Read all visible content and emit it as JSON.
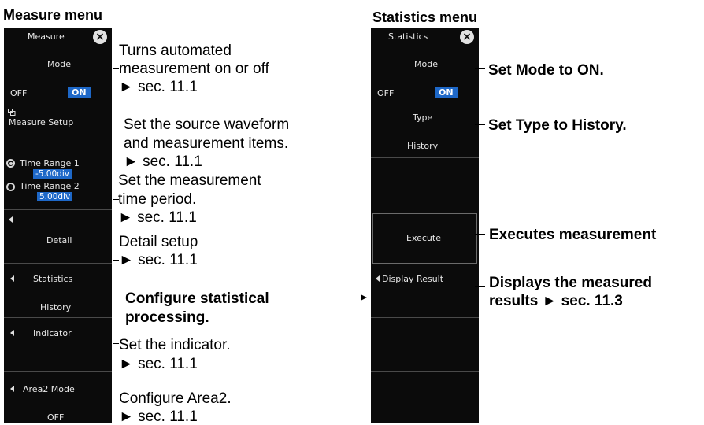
{
  "headings": {
    "measure": "Measure menu",
    "statistics": "Statistics menu"
  },
  "measure_panel": {
    "title": "Measure",
    "mode_label": "Mode",
    "mode_off": "OFF",
    "mode_on": "ON",
    "setup_label": "Measure Setup",
    "time_range1_label": "Time Range 1",
    "time_range1_value": "-5.00div",
    "time_range2_label": "Time Range 2",
    "time_range2_value": "5.00div",
    "detail_label": "Detail",
    "statistics_label": "Statistics",
    "statistics_value": "History",
    "indicator_label": "Indicator",
    "area2_label": "Area2 Mode",
    "area2_value": "OFF"
  },
  "statistics_panel": {
    "title": "Statistics",
    "mode_label": "Mode",
    "mode_off": "OFF",
    "mode_on": "ON",
    "type_label": "Type",
    "type_value": "History",
    "execute_label": "Execute",
    "display_result_label": "Display Result"
  },
  "annotations": {
    "mode_1": "Turns automated",
    "mode_2": "measurement on or off",
    "mode_3": "► sec. 11.1",
    "setup_1": "Set the source waveform",
    "setup_2": "and measurement items.",
    "setup_3": "► sec. 11.1",
    "time_1": "Set the measurement",
    "time_2": "time period.",
    "time_3": "► sec. 11.1",
    "detail_1": "Detail setup",
    "detail_2": "► sec. 11.1",
    "stats_1": "Configure statistical",
    "stats_2": "processing.",
    "indicator_1": "Set the indicator.",
    "indicator_2": "► sec. 11.1",
    "area2_1": "Configure Area2.",
    "area2_2": "► sec. 11.1",
    "smode": "Set Mode to ON.",
    "stype": "Set Type to History.",
    "execute": "Executes measurement",
    "display_1": "Displays the measured",
    "display_2": "results ► sec. 11.3"
  }
}
